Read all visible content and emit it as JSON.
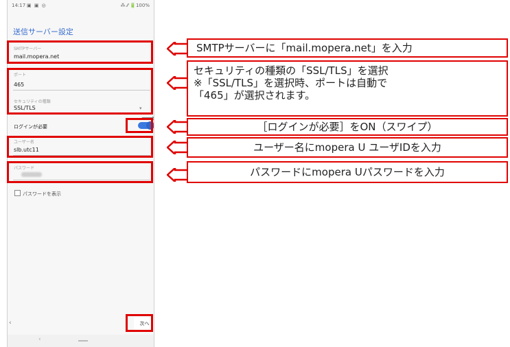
{
  "status_bar": {
    "time": "14:17",
    "icons": "▣ ▣ ◎",
    "right": "⁂ ⁄⁄ 🔋100%"
  },
  "screen": {
    "title": "送信サーバー設定",
    "smtp_server": {
      "label": "SMTPサーバー",
      "value": "mail.mopera.net"
    },
    "port": {
      "label": "ポート",
      "value": "465"
    },
    "security": {
      "label": "セキュリティの種類",
      "value": "SSL/TLS"
    },
    "login_required": {
      "label": "ログインが必要",
      "on": true
    },
    "username": {
      "label": "ユーザー名",
      "value": "slb.utc11"
    },
    "password": {
      "label": "パスワード"
    },
    "show_password": {
      "label": "パスワードを表示"
    },
    "next_button": "次へ ›",
    "back_chevron": "‹"
  },
  "annotations": [
    {
      "lines": [
        "SMTPサーバーに「mail.mopera.net」を入力"
      ]
    },
    {
      "lines": [
        "セキュリティの種類の「SSL/TLS」を選択",
        "※「SSL/TLS」を選択時、ポートは自動で",
        "「465」が選択されます。"
      ]
    },
    {
      "lines": [
        "［ログインが必要］をON（スワイプ）"
      ]
    },
    {
      "lines": [
        "ユーザー名にmopera U ユーザIDを入力"
      ]
    },
    {
      "lines": [
        "パスワードにmopera Uパスワードを入力"
      ]
    }
  ],
  "colors": {
    "highlight": "#e00000",
    "accent": "#3a6fcf",
    "toggle": "#3a7ae0"
  }
}
